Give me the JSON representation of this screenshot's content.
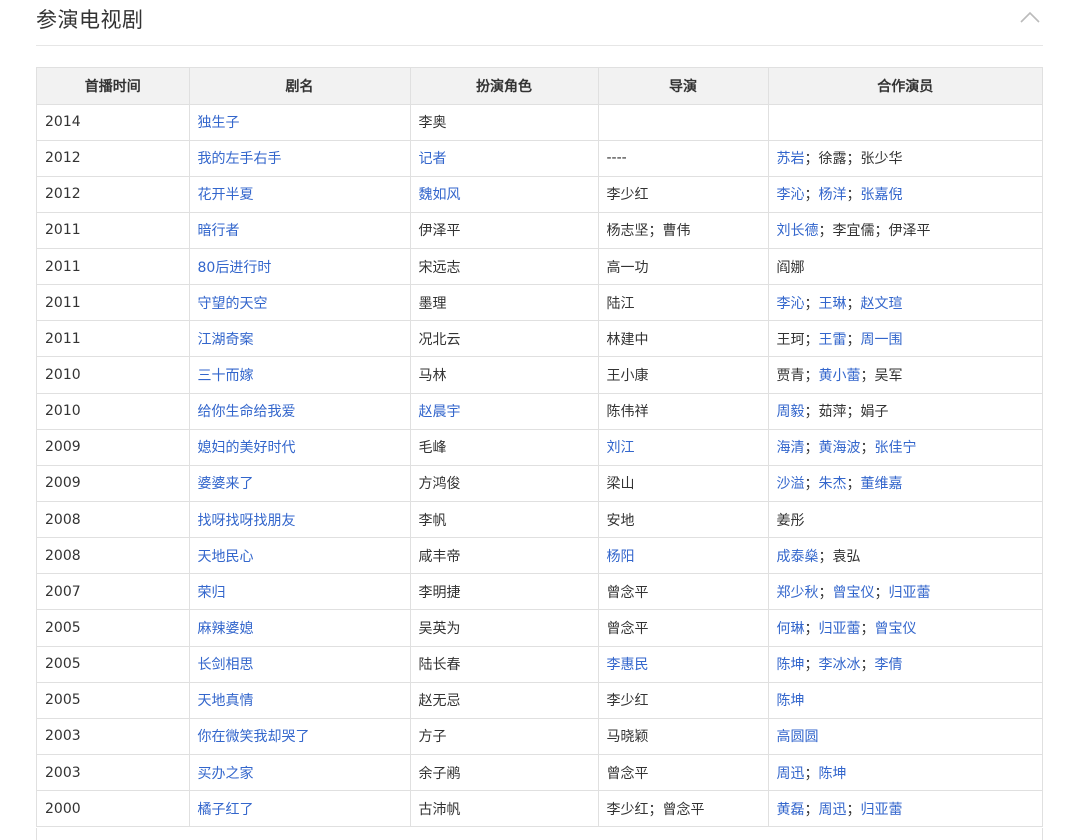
{
  "section": {
    "title": "参演电视剧",
    "collapse_icon": "chevron-up-icon"
  },
  "colors": {
    "link": "#3366cc",
    "text": "#333333",
    "header_bg": "#f2f2f2",
    "border": "#e0e0e0"
  },
  "table": {
    "headers": [
      "首播时间",
      "剧名",
      "扮演角色",
      "导演",
      "合作演员"
    ],
    "rows": [
      {
        "year": "2014",
        "title": "独生子",
        "role": [
          {
            "t": "李奥",
            "l": false
          }
        ],
        "director": [],
        "costars": []
      },
      {
        "year": "2012",
        "title": "我的左手右手",
        "role": [
          {
            "t": "记者",
            "l": true
          }
        ],
        "director": [
          {
            "t": "----",
            "l": false
          }
        ],
        "costars": [
          {
            "t": "苏岩",
            "l": true
          },
          {
            "t": "徐露",
            "l": false
          },
          {
            "t": "张少华",
            "l": false
          }
        ]
      },
      {
        "year": "2012",
        "title": "花开半夏",
        "role": [
          {
            "t": "魏如风",
            "l": true
          }
        ],
        "director": [
          {
            "t": "李少红",
            "l": false
          }
        ],
        "costars": [
          {
            "t": "李沁",
            "l": true
          },
          {
            "t": "杨洋",
            "l": true
          },
          {
            "t": "张嘉倪",
            "l": true
          }
        ]
      },
      {
        "year": "2011",
        "title": "暗行者",
        "role": [
          {
            "t": "伊泽平",
            "l": false
          }
        ],
        "director": [
          {
            "t": "杨志坚",
            "l": false
          },
          {
            "t": "曹伟",
            "l": false
          }
        ],
        "costars": [
          {
            "t": "刘长德",
            "l": true
          },
          {
            "t": "李宜儒",
            "l": false
          },
          {
            "t": "伊泽平",
            "l": false
          }
        ]
      },
      {
        "year": "2011",
        "title": "80后进行时",
        "role": [
          {
            "t": "宋远志",
            "l": false
          }
        ],
        "director": [
          {
            "t": "高一功",
            "l": false
          }
        ],
        "costars": [
          {
            "t": "阎娜",
            "l": false
          }
        ]
      },
      {
        "year": "2011",
        "title": "守望的天空",
        "role": [
          {
            "t": "墨理",
            "l": false
          }
        ],
        "director": [
          {
            "t": "陆江",
            "l": false
          }
        ],
        "costars": [
          {
            "t": "李沁",
            "l": true
          },
          {
            "t": "王琳",
            "l": true
          },
          {
            "t": "赵文瑄",
            "l": true
          }
        ]
      },
      {
        "year": "2011",
        "title": "江湖奇案",
        "role": [
          {
            "t": "况北云",
            "l": false
          }
        ],
        "director": [
          {
            "t": "林建中",
            "l": false
          }
        ],
        "costars": [
          {
            "t": "王珂",
            "l": false
          },
          {
            "t": "王雷",
            "l": true
          },
          {
            "t": "周一围",
            "l": true
          }
        ]
      },
      {
        "year": "2010",
        "title": "三十而嫁",
        "role": [
          {
            "t": "马林",
            "l": false
          }
        ],
        "director": [
          {
            "t": "王小康",
            "l": false
          }
        ],
        "costars": [
          {
            "t": "贾青",
            "l": false
          },
          {
            "t": "黄小蕾",
            "l": true
          },
          {
            "t": "吴军",
            "l": false
          }
        ]
      },
      {
        "year": "2010",
        "title": "给你生命给我爱",
        "role": [
          {
            "t": "赵晨宇",
            "l": true
          }
        ],
        "director": [
          {
            "t": "陈伟祥",
            "l": false
          }
        ],
        "costars": [
          {
            "t": "周毅",
            "l": true
          },
          {
            "t": "茹萍",
            "l": false
          },
          {
            "t": "娟子",
            "l": false
          }
        ]
      },
      {
        "year": "2009",
        "title": "媳妇的美好时代",
        "role": [
          {
            "t": "毛峰",
            "l": false
          }
        ],
        "director": [
          {
            "t": "刘江",
            "l": true
          }
        ],
        "costars": [
          {
            "t": "海清",
            "l": true
          },
          {
            "t": "黄海波",
            "l": true
          },
          {
            "t": "张佳宁",
            "l": true
          }
        ]
      },
      {
        "year": "2009",
        "title": "婆婆来了",
        "role": [
          {
            "t": "方鸿俊",
            "l": false
          }
        ],
        "director": [
          {
            "t": "梁山",
            "l": false
          }
        ],
        "costars": [
          {
            "t": "沙溢",
            "l": true
          },
          {
            "t": "朱杰",
            "l": true
          },
          {
            "t": "董维嘉",
            "l": true
          }
        ]
      },
      {
        "year": "2008",
        "title": "找呀找呀找朋友",
        "role": [
          {
            "t": "李帆",
            "l": false
          }
        ],
        "director": [
          {
            "t": "安地",
            "l": false
          }
        ],
        "costars": [
          {
            "t": "姜彤",
            "l": false
          }
        ]
      },
      {
        "year": "2008",
        "title": "天地民心",
        "role": [
          {
            "t": "咸丰帝",
            "l": false
          }
        ],
        "director": [
          {
            "t": "杨阳",
            "l": true
          }
        ],
        "costars": [
          {
            "t": "成泰燊",
            "l": true
          },
          {
            "t": "袁弘",
            "l": false
          }
        ]
      },
      {
        "year": "2007",
        "title": "荣归",
        "role": [
          {
            "t": "李明捷",
            "l": false
          }
        ],
        "director": [
          {
            "t": "曾念平",
            "l": false
          }
        ],
        "costars": [
          {
            "t": "郑少秋",
            "l": true
          },
          {
            "t": "曾宝仪",
            "l": true
          },
          {
            "t": "归亚蕾",
            "l": true
          }
        ]
      },
      {
        "year": "2005",
        "title": "麻辣婆媳",
        "role": [
          {
            "t": "吴英为",
            "l": false
          }
        ],
        "director": [
          {
            "t": "曾念平",
            "l": false
          }
        ],
        "costars": [
          {
            "t": "何琳",
            "l": true
          },
          {
            "t": "归亚蕾",
            "l": true
          },
          {
            "t": "曾宝仪",
            "l": true
          }
        ]
      },
      {
        "year": "2005",
        "title": "长剑相思",
        "role": [
          {
            "t": "陆长春",
            "l": false
          }
        ],
        "director": [
          {
            "t": "李惠民",
            "l": true
          }
        ],
        "costars": [
          {
            "t": "陈坤",
            "l": true
          },
          {
            "t": "李冰冰",
            "l": true
          },
          {
            "t": "李倩",
            "l": true
          }
        ]
      },
      {
        "year": "2005",
        "title": "天地真情",
        "role": [
          {
            "t": "赵无忌",
            "l": false
          }
        ],
        "director": [
          {
            "t": "李少红",
            "l": false
          }
        ],
        "costars": [
          {
            "t": "陈坤",
            "l": true
          }
        ]
      },
      {
        "year": "2003",
        "title": "你在微笑我却哭了",
        "role": [
          {
            "t": "方子",
            "l": false
          }
        ],
        "director": [
          {
            "t": "马晓颖",
            "l": false
          }
        ],
        "costars": [
          {
            "t": "高圆圆",
            "l": true
          }
        ]
      },
      {
        "year": "2003",
        "title": "买办之家",
        "role": [
          {
            "t": "余子鹇",
            "l": false
          }
        ],
        "director": [
          {
            "t": "曾念平",
            "l": false
          }
        ],
        "costars": [
          {
            "t": "周迅",
            "l": true
          },
          {
            "t": "陈坤",
            "l": true
          }
        ]
      },
      {
        "year": "2000",
        "title": "橘子红了",
        "role": [
          {
            "t": "古沛帆",
            "l": false
          }
        ],
        "director": [
          {
            "t": "李少红",
            "l": false
          },
          {
            "t": "曾念平",
            "l": false
          }
        ],
        "costars": [
          {
            "t": "黄磊",
            "l": true
          },
          {
            "t": "周迅",
            "l": true
          },
          {
            "t": "归亚蕾",
            "l": true
          }
        ]
      }
    ],
    "separator": "；"
  }
}
